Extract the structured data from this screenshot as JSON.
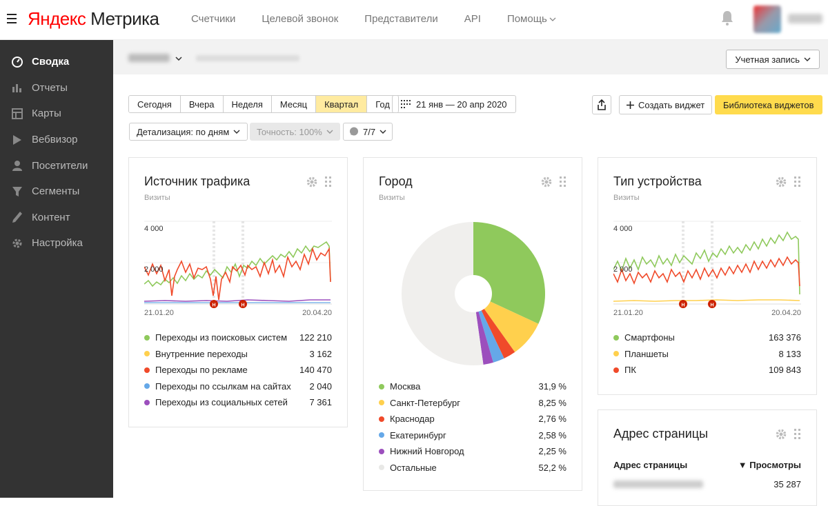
{
  "app": {
    "logo_brand": "Яндекс",
    "logo_product": "Метрика"
  },
  "topnav": [
    {
      "label": "Счетчики"
    },
    {
      "label": "Целевой звонок"
    },
    {
      "label": "Представители"
    },
    {
      "label": "API"
    },
    {
      "label": "Помощь"
    }
  ],
  "sidebar": {
    "items": [
      {
        "label": "Сводка",
        "icon": "gauge-icon",
        "active": true
      },
      {
        "label": "Отчеты",
        "icon": "bar-chart-icon"
      },
      {
        "label": "Карты",
        "icon": "map-icon"
      },
      {
        "label": "Вебвизор",
        "icon": "play-icon"
      },
      {
        "label": "Посетители",
        "icon": "user-icon"
      },
      {
        "label": "Сегменты",
        "icon": "filter-icon"
      },
      {
        "label": "Контент",
        "icon": "pencil-icon"
      },
      {
        "label": "Настройка",
        "icon": "gear-icon"
      }
    ]
  },
  "subbar": {
    "account_label": "Учетная запись"
  },
  "toolbar": {
    "periods": [
      "Сегодня",
      "Вчера",
      "Неделя",
      "Месяц",
      "Квартал",
      "Год"
    ],
    "selected_period": "Квартал",
    "date_range": "21 янв — 20 апр 2020",
    "create_widget": "Создать виджет",
    "widget_library": "Библиотека виджетов",
    "detail": "Детализация: по дням",
    "accuracy": "Точность: 100%",
    "notes_count": "7/7"
  },
  "colors": {
    "green": "#8fc95c",
    "yellow": "#ffd04d",
    "red": "#f04a2a",
    "blue": "#65a8e8",
    "purple": "#9c4fbd",
    "gray": "#f0efed",
    "accent": "#ffdb4d"
  },
  "traffic": {
    "title": "Источник трафика",
    "subtitle": "Визиты",
    "y_ticks": [
      "4 000",
      "2 000"
    ],
    "x_start": "21.01.20",
    "x_end": "20.04.20",
    "legend": [
      {
        "label": "Переходы из поисковых систем",
        "value": "122 210",
        "color": "#8fc95c"
      },
      {
        "label": "Внутренние переходы",
        "value": "3 162",
        "color": "#ffd04d"
      },
      {
        "label": "Переходы по рекламе",
        "value": "140 470",
        "color": "#f04a2a"
      },
      {
        "label": "Переходы по ссылкам на сайтах",
        "value": "2 040",
        "color": "#65a8e8"
      },
      {
        "label": "Переходы из социальных сетей",
        "value": "7 361",
        "color": "#9c4fbd"
      }
    ]
  },
  "city": {
    "title": "Город",
    "subtitle": "Визиты",
    "legend": [
      {
        "label": "Москва",
        "value": "31,9 %",
        "color": "#8fc95c"
      },
      {
        "label": "Санкт-Петербург",
        "value": "8,25 %",
        "color": "#ffd04d"
      },
      {
        "label": "Краснодар",
        "value": "2,76 %",
        "color": "#f04a2a"
      },
      {
        "label": "Екатеринбург",
        "value": "2,58 %",
        "color": "#65a8e8"
      },
      {
        "label": "Нижний Новгород",
        "value": "2,25 %",
        "color": "#9c4fbd"
      },
      {
        "label": "Остальные",
        "value": "52,2 %",
        "color": "#f0efed"
      }
    ]
  },
  "device": {
    "title": "Тип устройства",
    "subtitle": "Визиты",
    "y_ticks": [
      "4 000",
      "2 000"
    ],
    "x_start": "21.01.20",
    "x_end": "20.04.20",
    "legend": [
      {
        "label": "Смартфоны",
        "value": "163 376",
        "color": "#8fc95c"
      },
      {
        "label": "Планшеты",
        "value": "8 133",
        "color": "#ffd04d"
      },
      {
        "label": "ПК",
        "value": "109 843",
        "color": "#f04a2a"
      }
    ]
  },
  "pages": {
    "title": "Адрес страницы",
    "col1": "Адрес страницы",
    "col2": "▼ Просмотры",
    "row1_value": "35 287"
  },
  "chart_data": [
    {
      "type": "line",
      "title": "Источник трафика",
      "ylabel": "Визиты",
      "x": [
        "21.01.20",
        "20.04.20"
      ],
      "ylim": [
        0,
        4500
      ],
      "series": [
        {
          "name": "Переходы из поисковых систем",
          "trend": [
            1500,
            1900,
            2400,
            3300
          ]
        },
        {
          "name": "Переходы по рекламе",
          "trend": [
            1900,
            1800,
            2000,
            2900
          ]
        },
        {
          "name": "Переходы из социальных сетей",
          "trend": [
            100,
            120,
            100,
            150
          ]
        }
      ]
    },
    {
      "type": "pie",
      "title": "Город",
      "categories": [
        "Москва",
        "Санкт-Петербург",
        "Краснодар",
        "Екатеринбург",
        "Нижний Новгород",
        "Остальные"
      ],
      "values": [
        31.9,
        8.25,
        2.76,
        2.58,
        2.25,
        52.2
      ]
    },
    {
      "type": "line",
      "title": "Тип устройства",
      "ylabel": "Визиты",
      "x": [
        "21.01.20",
        "20.04.20"
      ],
      "ylim": [
        0,
        4500
      ],
      "series": [
        {
          "name": "Смартфоны",
          "trend": [
            1800,
            2400,
            2700,
            3500
          ]
        },
        {
          "name": "ПК",
          "trend": [
            1700,
            1600,
            1800,
            2200
          ]
        },
        {
          "name": "Планшеты",
          "trend": [
            100,
            110,
            110,
            120
          ]
        }
      ]
    }
  ]
}
